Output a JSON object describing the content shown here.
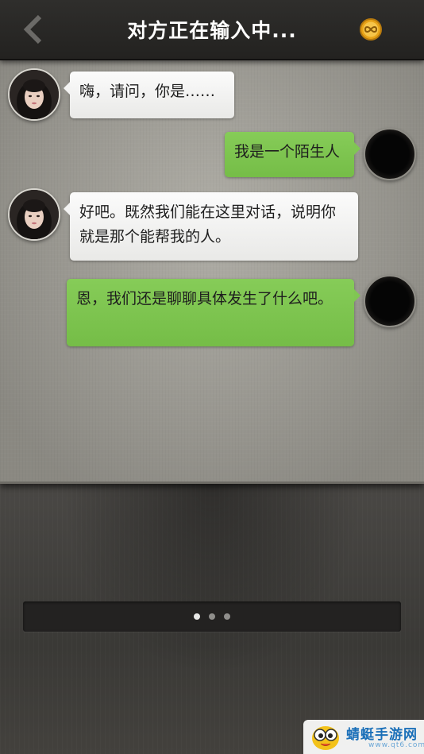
{
  "header": {
    "title": "对方正在输入中...",
    "back_icon": "chevron-left-icon",
    "coin_icon": "infinity-coin-icon"
  },
  "chat": {
    "messages": [
      {
        "sender": "her",
        "text": "嗨，请问，你是……"
      },
      {
        "sender": "me",
        "text": "我是一个陌生人"
      },
      {
        "sender": "her",
        "text": "好吧。既然我们能在这里对话，说明你就是那个能帮我的人。"
      },
      {
        "sender": "me",
        "text": "恩，我们还是聊聊具体发生了什么吧。"
      }
    ]
  },
  "options": {
    "page_count": 3,
    "active_page": 0
  },
  "watermark": {
    "name": "蜻蜓手游网",
    "url": "www.qt6.com"
  },
  "colors": {
    "green_bubble": "#7fc650",
    "white_bubble": "#f3f3f2",
    "header_bg": "#2a2927",
    "accent_coin": "#e8a317"
  }
}
